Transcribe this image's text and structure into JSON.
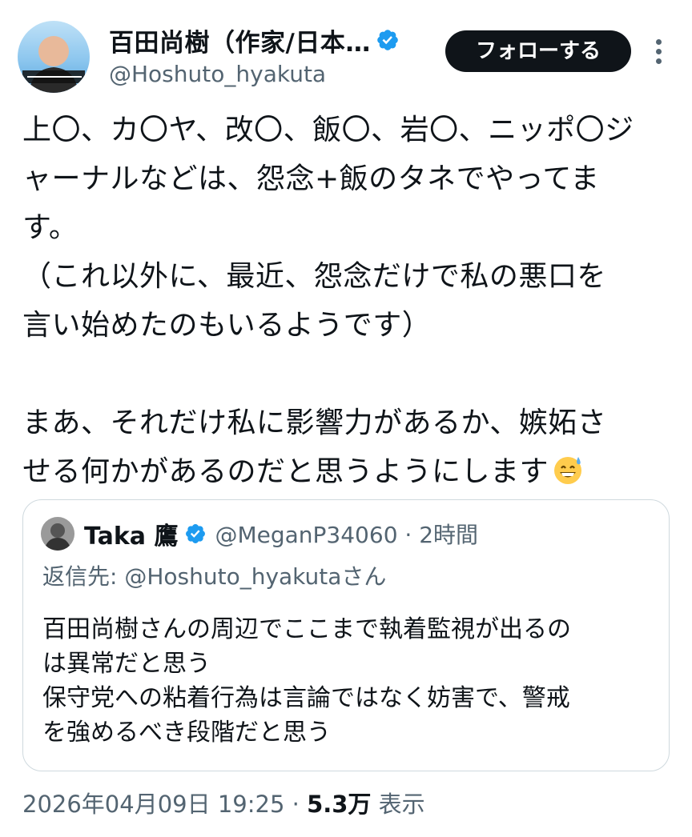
{
  "author": {
    "display_name": "百田尚樹（作家/日本…",
    "handle": "@Hoshuto_hyakuta",
    "avatar_caption": "百田尚樹"
  },
  "actions": {
    "follow_label": "フォローする",
    "more_icon": "more-vertical-icon"
  },
  "tweet": {
    "lines": [
      "上〇、カ〇ヤ、改〇、飯〇、岩〇、ニッポ〇ジ",
      "ャーナルなどは、怨念+飯のタネでやってま",
      "す。",
      "（これ以外に、最近、怨念だけで私の悪口を",
      "言い始めたのもいるようです）",
      "",
      "まあ、それだけ私に影響力があるか、嫉妬さ",
      "せる何かがあるのだと思うようにします"
    ],
    "emoji": "grinning-face-with-sweat-emoji"
  },
  "quote": {
    "name": "Taka 鷹",
    "handle_time": "@MeganP34060 · 2時間",
    "reply_to": "返信先: @Hoshuto_hyakutaさん",
    "lines": [
      "百田尚樹さんの周辺でここまで執着監視が出るの",
      "は異常だと思う",
      "保守党への粘着行為は言論ではなく妨害で、警戒",
      "を強めるべき段階だと思う"
    ]
  },
  "meta": {
    "timestamp": "2026年04月09日 19:25 · ",
    "views_count": "5.3万",
    "views_label": " 表示"
  },
  "colors": {
    "verified": "#1d9bf0",
    "secondary_text": "#536471",
    "primary_text": "#0f1419",
    "border": "#cfd9de"
  }
}
